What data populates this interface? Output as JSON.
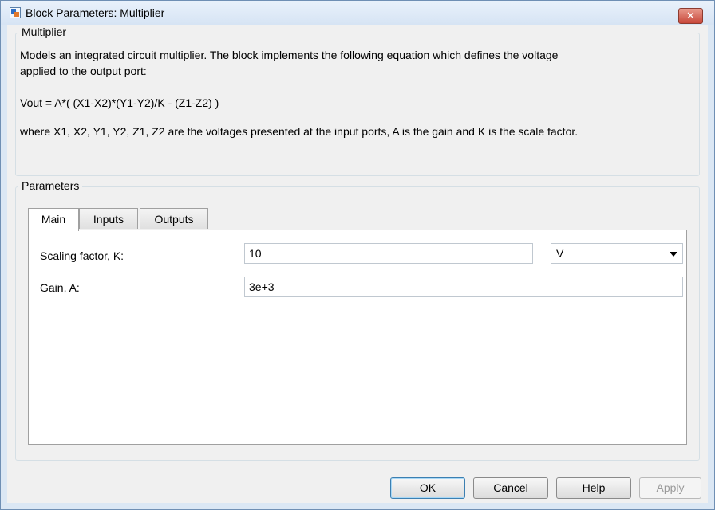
{
  "window": {
    "title": "Block Parameters: Multiplier",
    "close_glyph": "✕"
  },
  "description_group": {
    "title": "Multiplier",
    "line1": "Models an integrated circuit multiplier. The block implements the following equation which defines the voltage",
    "line2": "applied to the output port:",
    "equation": "Vout = A*( (X1-X2)*(Y1-Y2)/K - (Z1-Z2) )",
    "where_text": "where X1, X2, Y1, Y2, Z1, Z2 are the voltages presented at the input ports, A is the gain and K is the scale factor."
  },
  "parameters_group": {
    "title": "Parameters",
    "tabs": [
      {
        "label": "Main",
        "active": true
      },
      {
        "label": "Inputs",
        "active": false
      },
      {
        "label": "Outputs",
        "active": false
      }
    ],
    "fields": {
      "scaling": {
        "label": "Scaling factor, K:",
        "value": "10",
        "unit": "V"
      },
      "gain": {
        "label": "Gain, A:",
        "value": "3e+3"
      }
    }
  },
  "buttons": {
    "ok": "OK",
    "cancel": "Cancel",
    "help": "Help",
    "apply": "Apply"
  },
  "icons": {
    "app": "simulink-block-icon",
    "close": "close-icon",
    "dropdown": "chevron-down-icon"
  },
  "colors": {
    "title_bar": "#dbe7f4",
    "close_button": "#c8473a",
    "default_button_border": "#3c7fb1"
  }
}
